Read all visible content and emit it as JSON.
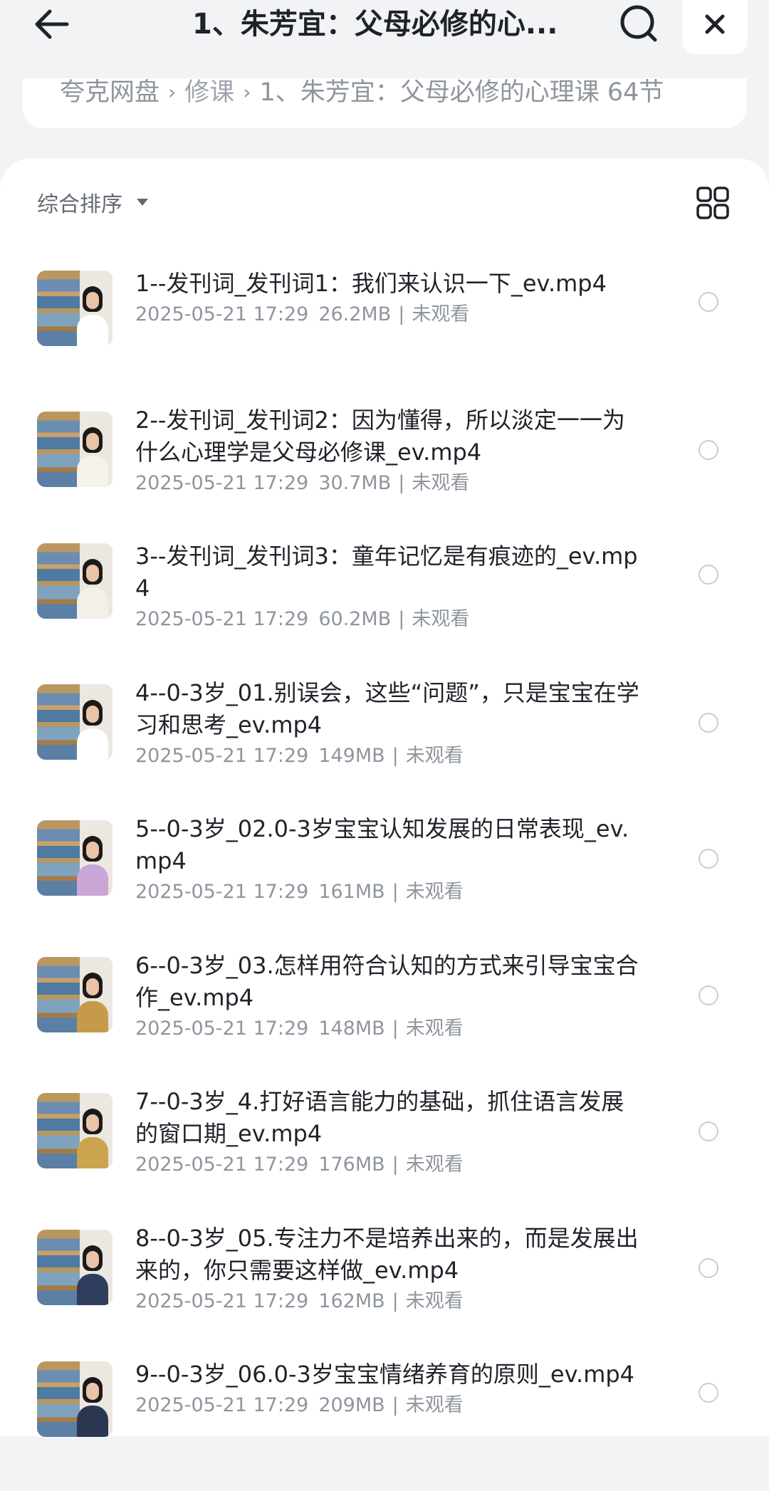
{
  "header": {
    "title": "1、朱芳宜：父母必修的心..."
  },
  "breadcrumb": {
    "items": [
      "夸克网盘",
      "修课",
      "1、朱芳宜：父母必修的心理课 64节"
    ]
  },
  "toolbar": {
    "sort_label": "综合排序"
  },
  "files": [
    {
      "name": "1--发刊词_发刊词1：我们来认识一下_ev.mp4",
      "date": "2025-05-21 17:29",
      "size": "26.2MB",
      "status": "未观看"
    },
    {
      "name": "2--发刊词_发刊词2：因为懂得，所以淡定一一为什么心理学是父母必修课_ev.mp4",
      "date": "2025-05-21 17:29",
      "size": "30.7MB",
      "status": "未观看"
    },
    {
      "name": "3--发刊词_发刊词3：童年记忆是有痕迹的_ev.mp4",
      "date": "2025-05-21 17:29",
      "size": "60.2MB",
      "status": "未观看"
    },
    {
      "name": "4--0-3岁_01.别误会，这些“问题”，只是宝宝在学习和思考_ev.mp4",
      "date": "2025-05-21 17:29",
      "size": "149MB",
      "status": "未观看"
    },
    {
      "name": "5--0-3岁_02.0-3岁宝宝认知发展的日常表现_ev.mp4",
      "date": "2025-05-21 17:29",
      "size": "161MB",
      "status": "未观看"
    },
    {
      "name": "6--0-3岁_03.怎样用符合认知的方式来引导宝宝合作_ev.mp4",
      "date": "2025-05-21 17:29",
      "size": "148MB",
      "status": "未观看"
    },
    {
      "name": "7--0-3岁_4.打好语言能力的基础，抓住语言发展的窗口期_ev.mp4",
      "date": "2025-05-21 17:29",
      "size": "176MB",
      "status": "未观看"
    },
    {
      "name": "8--0-3岁_05.专注力不是培养出来的，而是发展出来的，你只需要这样做_ev.mp4",
      "date": "2025-05-21 17:29",
      "size": "162MB",
      "status": "未观看"
    },
    {
      "name": "9--0-3岁_06.0-3岁宝宝情绪养育的原则_ev.mp4",
      "date": "2025-05-21 17:29",
      "size": "209MB",
      "status": "未观看"
    }
  ],
  "icons": {
    "back": "arrow-left-icon",
    "search": "search-icon",
    "close": "close-icon",
    "sort_caret": "caret-down-icon",
    "grid": "grid-view-icon",
    "select": "radio-circle-icon"
  },
  "colors": {
    "background": "#f2f3f5",
    "card": "#ffffff",
    "text_primary": "#1f2329",
    "text_secondary": "#8f959e",
    "radio_border": "#c9cdd4"
  }
}
